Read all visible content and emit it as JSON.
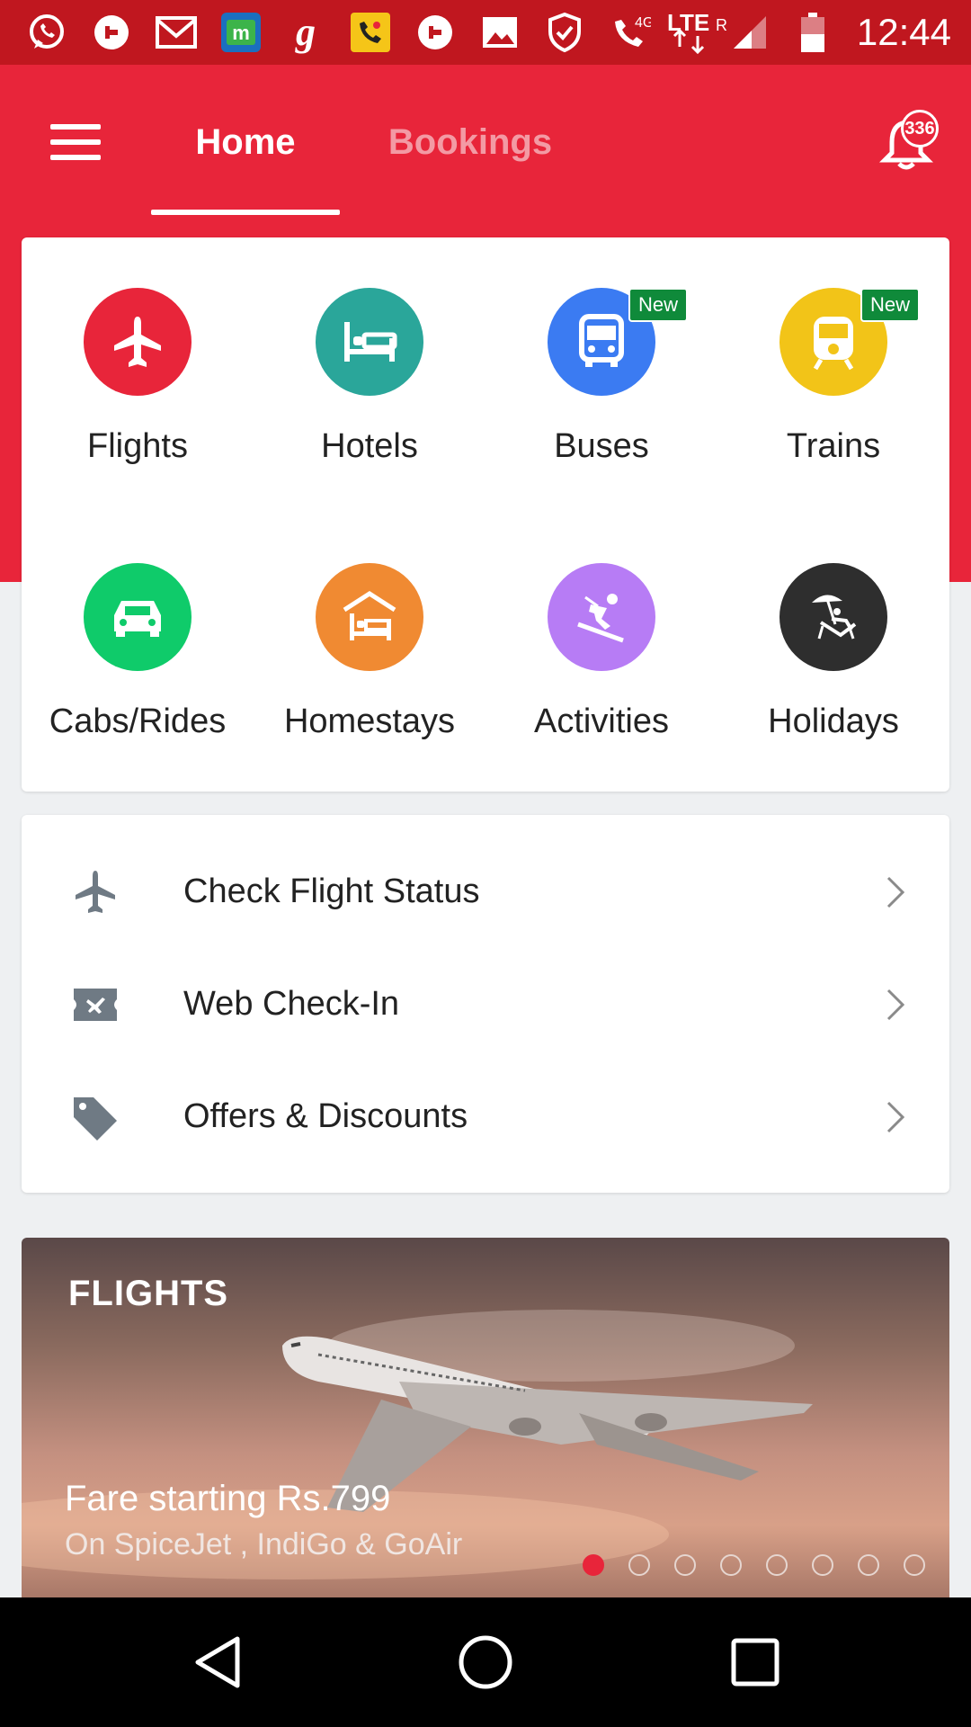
{
  "status_bar": {
    "time": "12:44",
    "network": "LTE",
    "network_type": "4G",
    "notification_icons": [
      "whatsapp-icon",
      "uber-icon",
      "gmail-icon",
      "app-m-icon",
      "goibibo-icon",
      "call-app-icon",
      "uber-icon",
      "gallery-icon",
      "shield-icon",
      "wifi-call-icon"
    ]
  },
  "header": {
    "tabs": [
      {
        "label": "Home",
        "active": true
      },
      {
        "label": "Bookings",
        "active": false
      }
    ],
    "notification_count": "336",
    "accent_color": "#e8253a"
  },
  "categories": [
    {
      "label": "Flights",
      "icon": "airplane-icon",
      "color": "#e8253a",
      "badge": ""
    },
    {
      "label": "Hotels",
      "icon": "bed-icon",
      "color": "#2aa69a",
      "badge": ""
    },
    {
      "label": "Buses",
      "icon": "bus-icon",
      "color": "#3b7bf2",
      "badge": "New"
    },
    {
      "label": "Trains",
      "icon": "train-icon",
      "color": "#f2c418",
      "badge": "New"
    },
    {
      "label": "Cabs/Rides",
      "icon": "car-icon",
      "color": "#0fcb6a",
      "badge": ""
    },
    {
      "label": "Homestays",
      "icon": "homestay-icon",
      "color": "#f08a32",
      "badge": ""
    },
    {
      "label": "Activities",
      "icon": "skier-icon",
      "color": "#b77cf5",
      "badge": ""
    },
    {
      "label": "Holidays",
      "icon": "beach-chair-icon",
      "color": "#2e2e2e",
      "badge": ""
    }
  ],
  "quick_links": [
    {
      "label": "Check Flight Status",
      "icon": "airplane-icon"
    },
    {
      "label": "Web Check-In",
      "icon": "boarding-pass-icon"
    },
    {
      "label": "Offers & Discounts",
      "icon": "tag-icon"
    }
  ],
  "banner": {
    "tag": "FLIGHTS",
    "title": "Fare starting Rs.799",
    "subtitle": "On SpiceJet , IndiGo & GoAir",
    "slide_count": 8,
    "active_slide": 1
  }
}
